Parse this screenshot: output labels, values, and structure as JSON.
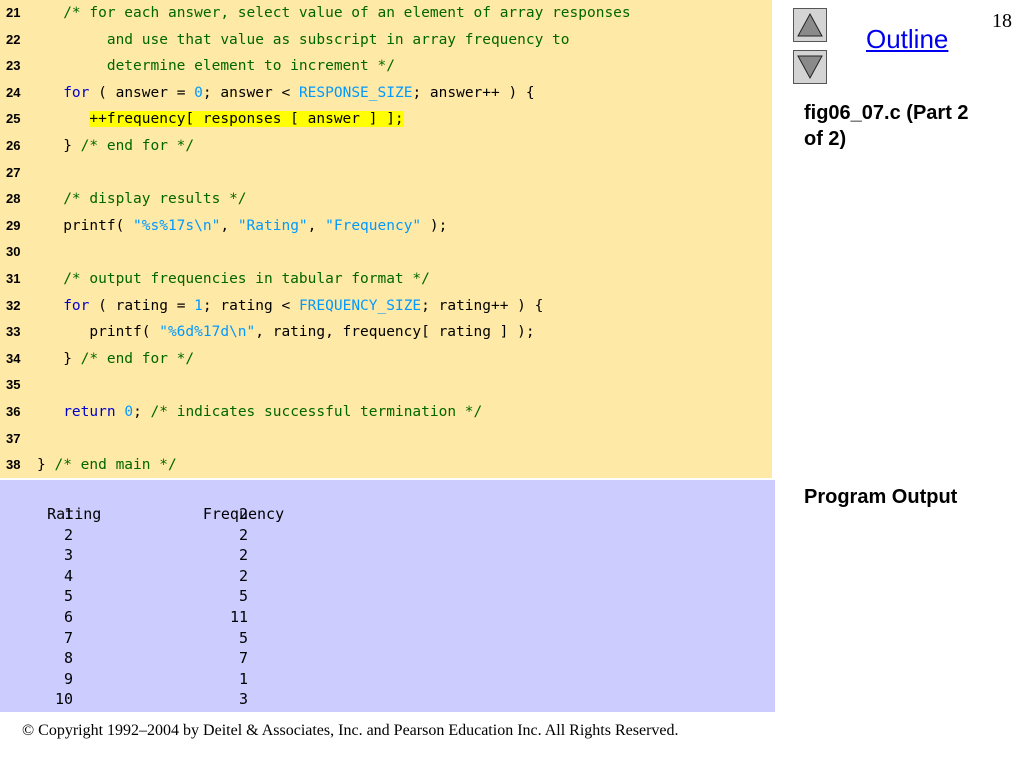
{
  "slide": {
    "page_number": "18",
    "outline_label": "Outline",
    "file_label": "fig06_07.c (Part 2\nof 2)",
    "file_label_line1": "fig06_07.c (Part 2",
    "file_label_line2": "of 2)",
    "output_label": "Program Output",
    "copyright": "© Copyright 1992–2004 by Deitel & Associates, Inc. and Pearson Education Inc. All Rights Reserved."
  },
  "code": {
    "lines": [
      {
        "n": "21",
        "segs": [
          {
            "t": "   "
          },
          {
            "t": "/* for each answer, select value of an element of array responses",
            "c": "cm"
          }
        ]
      },
      {
        "n": "22",
        "segs": [
          {
            "t": "        "
          },
          {
            "t": "and use that value as subscript in array frequency to",
            "c": "cm"
          }
        ]
      },
      {
        "n": "23",
        "segs": [
          {
            "t": "        "
          },
          {
            "t": "determine element to increment */",
            "c": "cm"
          }
        ]
      },
      {
        "n": "24",
        "segs": [
          {
            "t": "   "
          },
          {
            "t": "for",
            "c": "kw"
          },
          {
            "t": " ( answer = "
          },
          {
            "t": "0",
            "c": "nm"
          },
          {
            "t": "; answer < "
          },
          {
            "t": "RESPONSE_SIZE",
            "c": "nm"
          },
          {
            "t": "; answer++ ) {"
          }
        ]
      },
      {
        "n": "25",
        "segs": [
          {
            "t": "      "
          },
          {
            "t": "++frequency[ responses [ answer ] ];",
            "c": "hl"
          }
        ]
      },
      {
        "n": "26",
        "segs": [
          {
            "t": "   } "
          },
          {
            "t": "/* end for */",
            "c": "cm"
          }
        ]
      },
      {
        "n": "27",
        "segs": [
          {
            "t": ""
          }
        ]
      },
      {
        "n": "28",
        "segs": [
          {
            "t": "   "
          },
          {
            "t": "/* display results */",
            "c": "cm"
          }
        ]
      },
      {
        "n": "29",
        "segs": [
          {
            "t": "   printf( "
          },
          {
            "t": "\"%s%17s\\n\"",
            "c": "st"
          },
          {
            "t": ", "
          },
          {
            "t": "\"Rating\"",
            "c": "st"
          },
          {
            "t": ", "
          },
          {
            "t": "\"Frequency\"",
            "c": "st"
          },
          {
            "t": " );"
          }
        ]
      },
      {
        "n": "30",
        "segs": [
          {
            "t": ""
          }
        ]
      },
      {
        "n": "31",
        "segs": [
          {
            "t": "   "
          },
          {
            "t": "/* output frequencies in tabular format */",
            "c": "cm"
          }
        ]
      },
      {
        "n": "32",
        "segs": [
          {
            "t": "   "
          },
          {
            "t": "for",
            "c": "kw"
          },
          {
            "t": " ( rating = "
          },
          {
            "t": "1",
            "c": "nm"
          },
          {
            "t": "; rating < "
          },
          {
            "t": "FREQUENCY_SIZE",
            "c": "nm"
          },
          {
            "t": "; rating++ ) {"
          }
        ]
      },
      {
        "n": "33",
        "segs": [
          {
            "t": "      printf( "
          },
          {
            "t": "\"%6d%17d\\n\"",
            "c": "st"
          },
          {
            "t": ", rating, frequency[ rating ] );"
          }
        ]
      },
      {
        "n": "34",
        "segs": [
          {
            "t": "   } "
          },
          {
            "t": "/* end for */",
            "c": "cm"
          }
        ]
      },
      {
        "n": "35",
        "segs": [
          {
            "t": ""
          }
        ]
      },
      {
        "n": "36",
        "segs": [
          {
            "t": "   "
          },
          {
            "t": "return",
            "c": "kw"
          },
          {
            "t": " "
          },
          {
            "t": "0",
            "c": "nm"
          },
          {
            "t": "; "
          },
          {
            "t": "/* indicates successful termination */",
            "c": "cm"
          }
        ]
      },
      {
        "n": "37",
        "segs": [
          {
            "t": ""
          }
        ]
      },
      {
        "n": "38",
        "segs": [
          {
            "t": "} "
          },
          {
            "t": "/* end main */",
            "c": "cm"
          }
        ]
      }
    ]
  },
  "output": {
    "header": {
      "rating": "Rating",
      "frequency": "Frequency"
    },
    "rows": [
      {
        "rating": "1",
        "frequency": "2"
      },
      {
        "rating": "2",
        "frequency": "2"
      },
      {
        "rating": "3",
        "frequency": "2"
      },
      {
        "rating": "4",
        "frequency": "2"
      },
      {
        "rating": "5",
        "frequency": "5"
      },
      {
        "rating": "6",
        "frequency": "11"
      },
      {
        "rating": "7",
        "frequency": "5"
      },
      {
        "rating": "8",
        "frequency": "7"
      },
      {
        "rating": "9",
        "frequency": "1"
      },
      {
        "rating": "10",
        "frequency": "3"
      }
    ]
  },
  "icons": {
    "up": "triangle-up-icon",
    "down": "triangle-down-icon"
  }
}
